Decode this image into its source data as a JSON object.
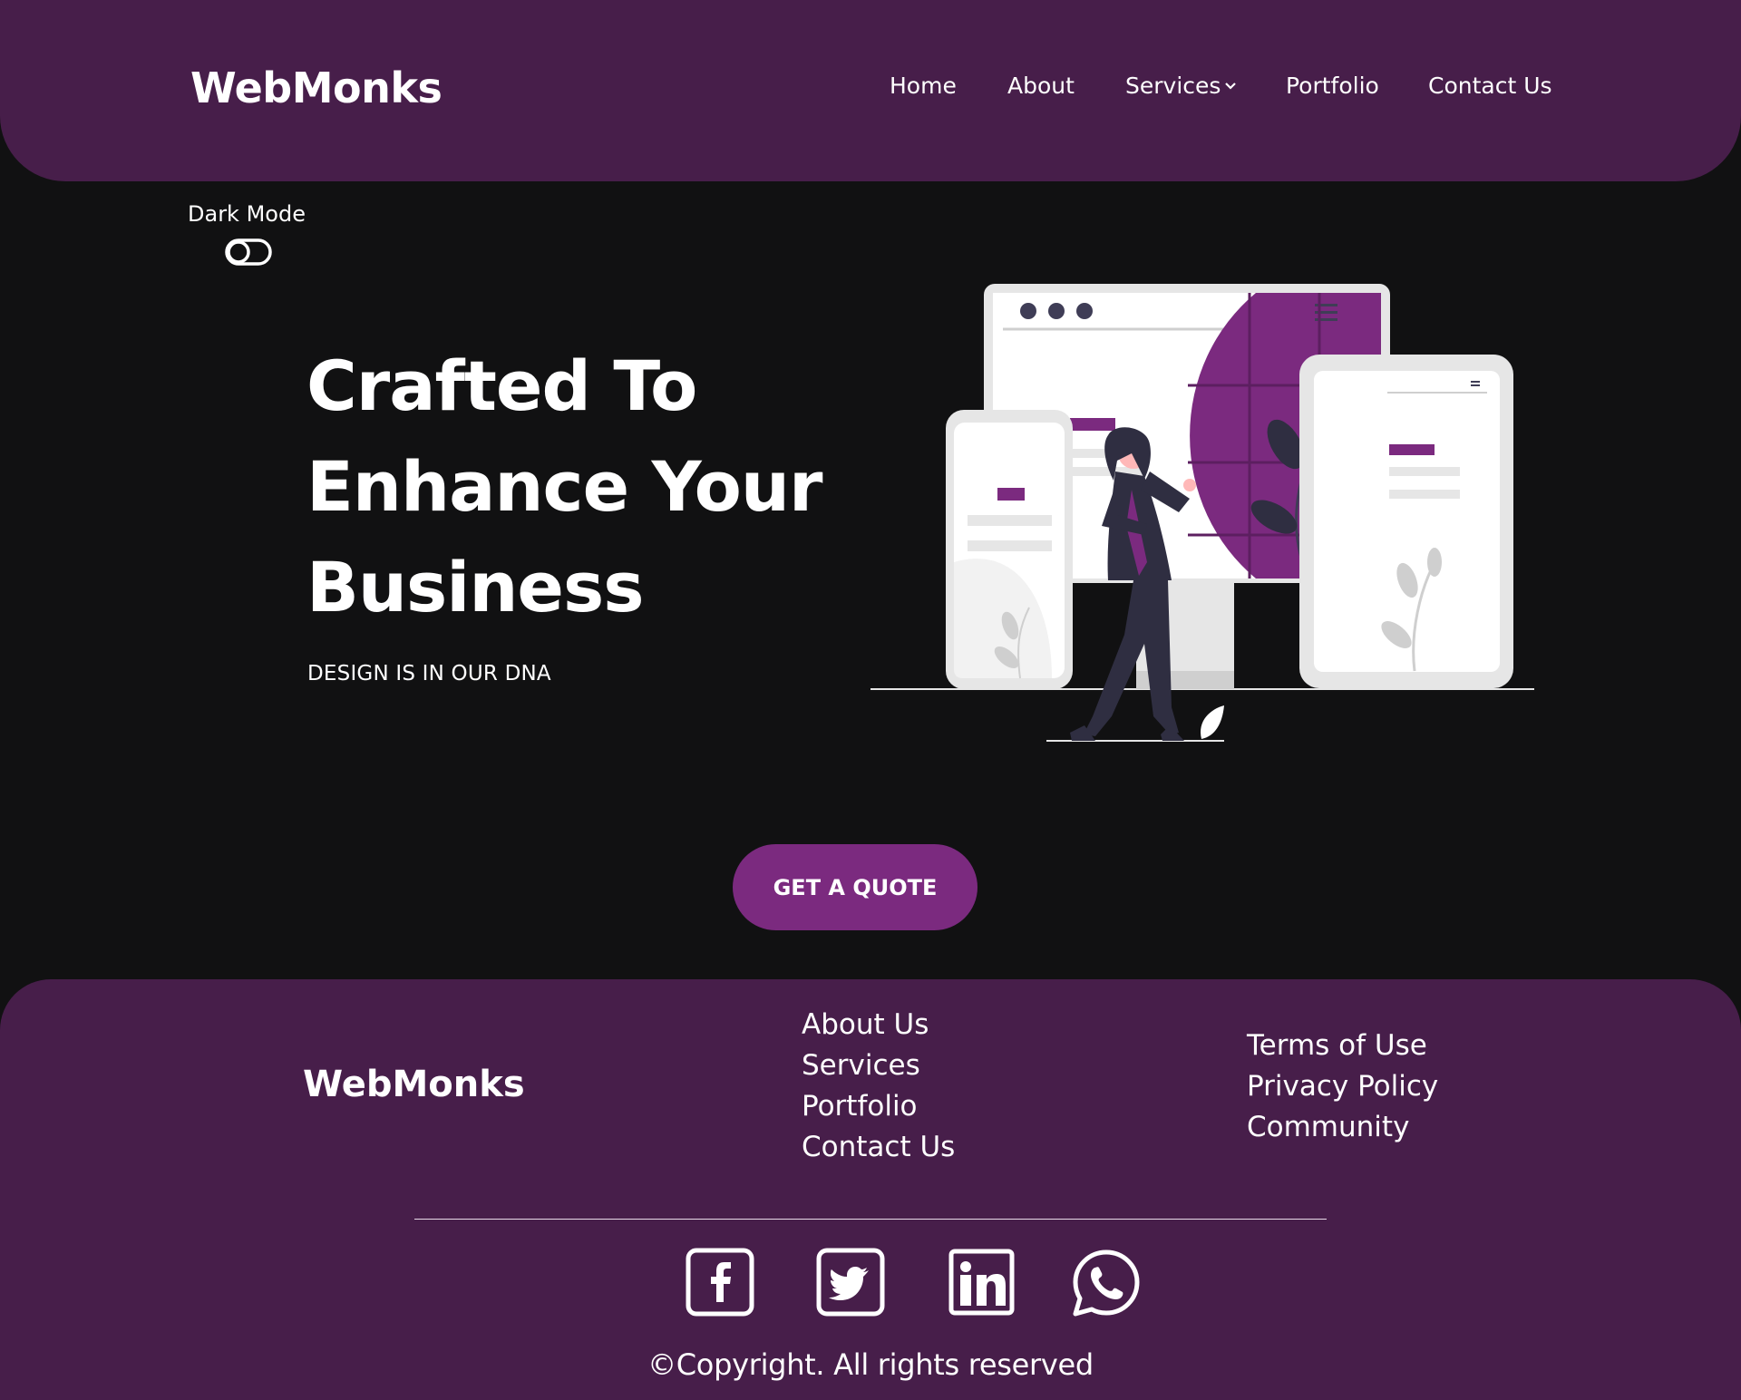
{
  "brand": {
    "name": "WebMonks"
  },
  "nav": {
    "items": [
      {
        "label": "Home"
      },
      {
        "label": "About"
      },
      {
        "label": "Services"
      },
      {
        "label": "Portfolio"
      },
      {
        "label": "Contact Us"
      }
    ]
  },
  "theme_toggle": {
    "label": "Dark Mode"
  },
  "hero": {
    "title_lines": [
      "Crafted To",
      "Enhance Your",
      "Business"
    ],
    "tagline": "DESIGN IS IN OUR DNA",
    "cta_label": "GET A QUOTE"
  },
  "footer": {
    "brand": "WebMonks",
    "links_col1": [
      "About Us",
      "Services",
      "Portfolio",
      "Contact Us"
    ],
    "links_col2": [
      "Terms of Use",
      "Privacy Policy",
      "Community"
    ],
    "social_icons": [
      "facebook-icon",
      "twitter-icon",
      "linkedin-icon",
      "whatsapp-icon"
    ],
    "copyright": "©Copyright. All rights reserved"
  },
  "colors": {
    "header_bg": "#471e4a",
    "page_bg": "#111112",
    "accent": "#7b2a7f",
    "text": "#ffffff"
  }
}
